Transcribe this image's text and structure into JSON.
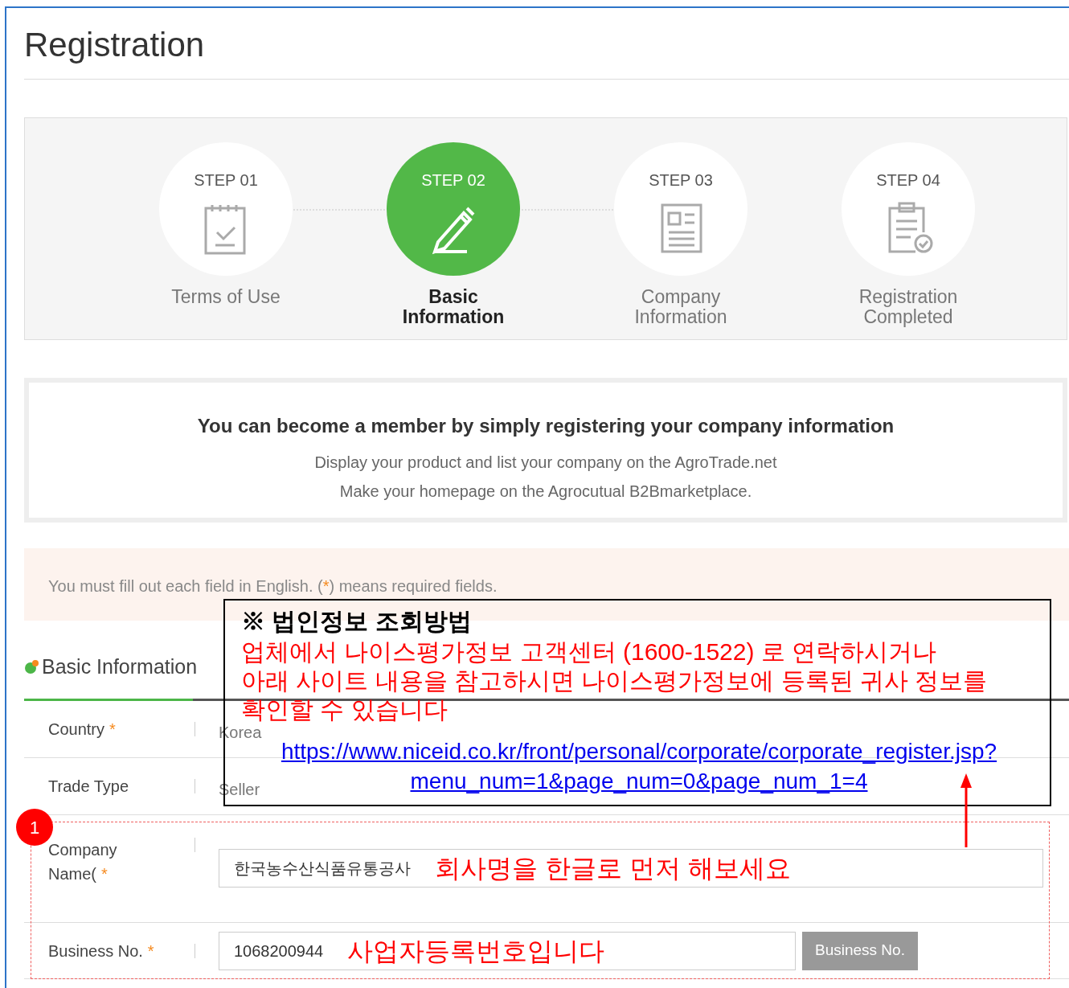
{
  "page_title": "Registration",
  "steps": [
    {
      "step": "STEP 01",
      "label": "Terms of Use",
      "selected": false
    },
    {
      "step": "STEP 02",
      "label": "Basic Information",
      "selected": true
    },
    {
      "step": "STEP 03",
      "label": "Company Information",
      "selected": false
    },
    {
      "step": "STEP 04",
      "label": "Registration Completed",
      "selected": false
    }
  ],
  "intro": {
    "heading": "You can become a member by simply registering your company information",
    "lines": [
      "Display your product and list your company on the AgroTrade.net",
      "Make your homepage on the Agrocutual B2Bmarketplace."
    ]
  },
  "notice": {
    "before": "You must fill out each field in English. (",
    "mark": "*",
    "after": ") means required fields."
  },
  "section_title": "Basic Information",
  "rows": [
    {
      "kind": "text",
      "label": "Country",
      "required": true,
      "value": "Korea"
    },
    {
      "kind": "text",
      "label": "Trade Type",
      "required": false,
      "value": "Seller"
    },
    {
      "kind": "field",
      "label": "Company Name(",
      "required": true,
      "value": "한국농수산식품유통공사",
      "note": "회사명을 한글로 먼저 해보세요"
    },
    {
      "kind": "field_button",
      "label": "Business No.",
      "required": true,
      "value": "1068200944",
      "note": "사업자등록번호입니다",
      "button": "Business No."
    }
  ],
  "callout": {
    "title": "※ 법인정보 조회방법",
    "lines": [
      "업체에서 나이스평가정보 고객센터 (1600-1522) 로 연락하시거나",
      "아래 사이트 내용을 참고하시면 나이스평가정보에 등록된 귀사 정보를",
      "확인할 수 있습니다"
    ],
    "link_lines": [
      "https://www.niceid.co.kr/front/personal/corporate/corporate_register.jsp?",
      "menu_num=1&page_num=0&page_num_1=4"
    ]
  },
  "badge": "1"
}
